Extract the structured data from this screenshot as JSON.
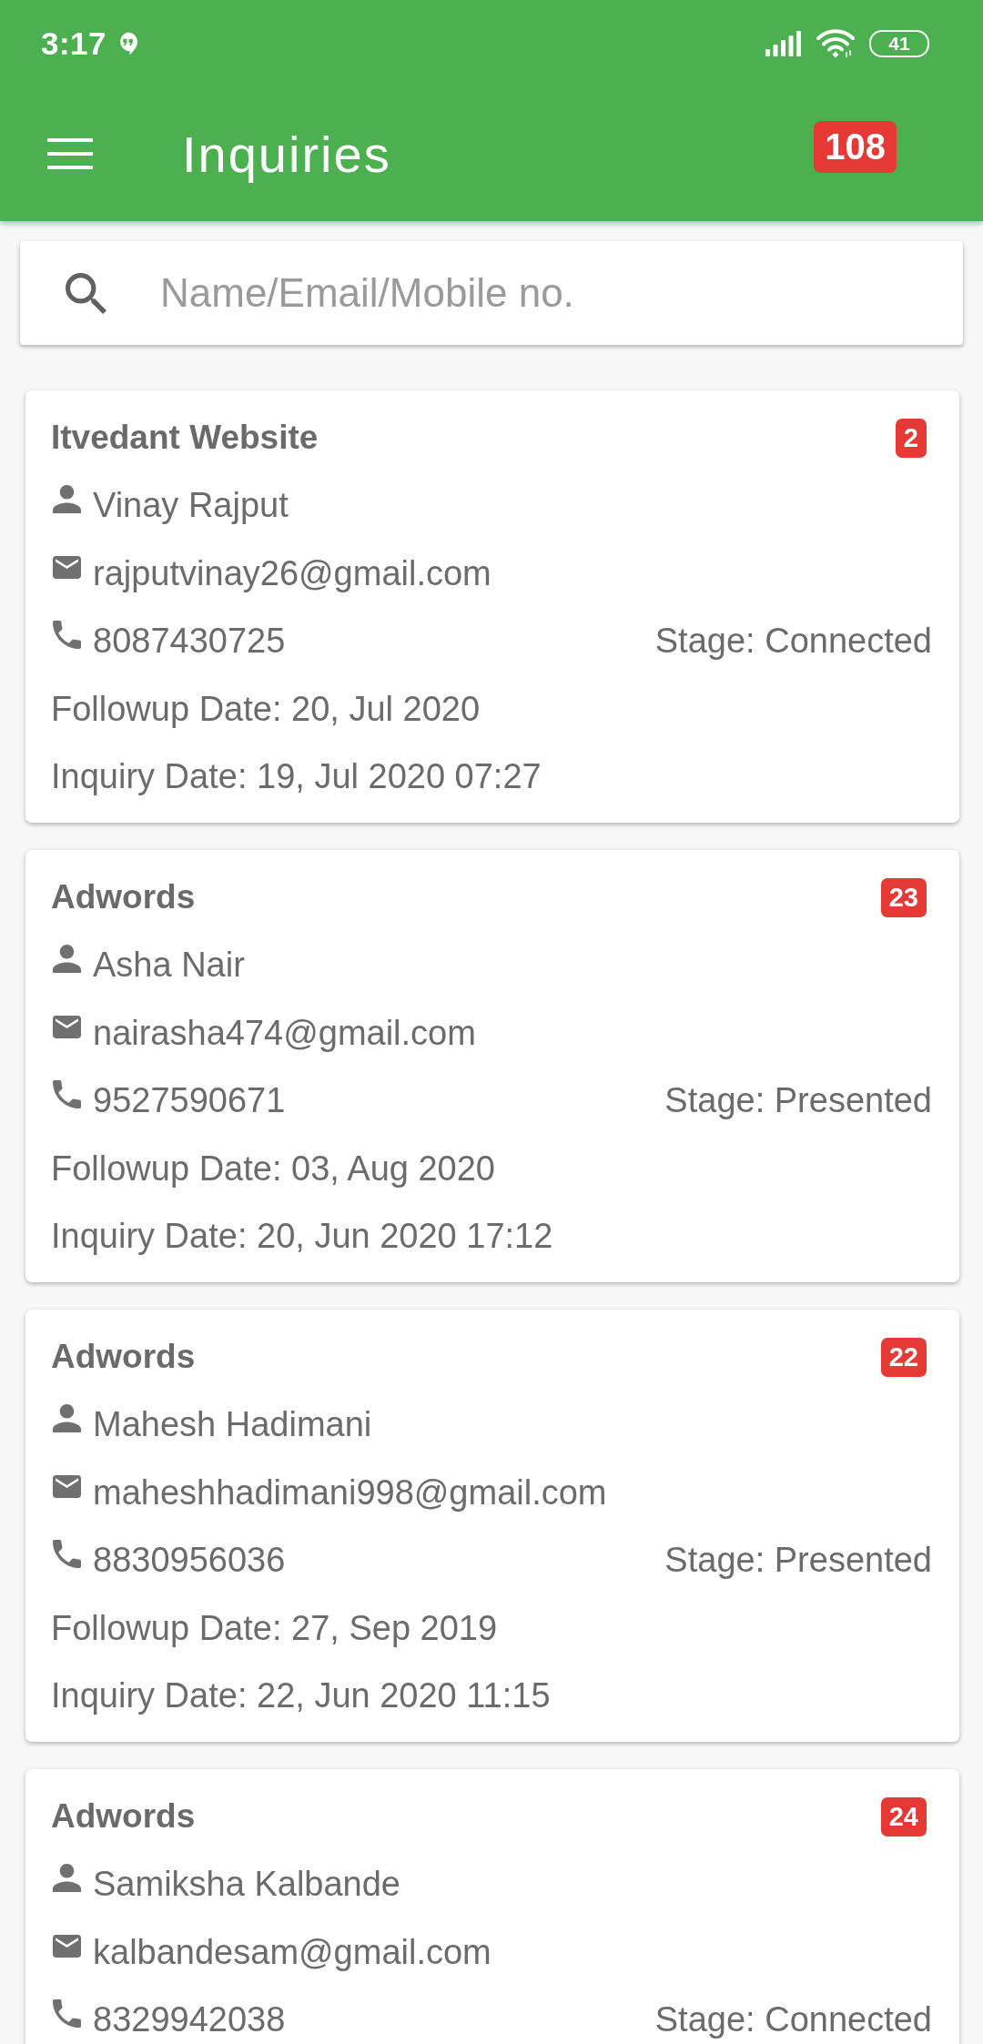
{
  "status_bar": {
    "time": "3:17",
    "battery": "41"
  },
  "toolbar": {
    "title": "Inquiries",
    "badge": "108"
  },
  "search": {
    "placeholder": "Name/Email/Mobile no."
  },
  "inquiries": [
    {
      "source": "Itvedant Website",
      "count": "2",
      "name": "Vinay Rajput",
      "email": "rajputvinay26@gmail.com",
      "phone": "8087430725",
      "stage": "Stage: Connected",
      "followup": "Followup Date: 20, Jul 2020",
      "inquiry_date": "Inquiry Date: 19, Jul 2020 07:27"
    },
    {
      "source": "Adwords",
      "count": "23",
      "name": "Asha Nair",
      "email": "nairasha474@gmail.com",
      "phone": "9527590671",
      "stage": "Stage: Presented",
      "followup": "Followup Date: 03, Aug 2020",
      "inquiry_date": "Inquiry Date: 20, Jun 2020 17:12"
    },
    {
      "source": "Adwords",
      "count": "22",
      "name": "Mahesh Hadimani",
      "email": "maheshhadimani998@gmail.com",
      "phone": "8830956036",
      "stage": "Stage: Presented",
      "followup": "Followup Date: 27, Sep 2019",
      "inquiry_date": "Inquiry Date: 22, Jun 2020 11:15"
    },
    {
      "source": "Adwords",
      "count": "24",
      "name": "Samiksha Kalbande",
      "email": "kalbandesam@gmail.com",
      "phone": "8329942038",
      "stage": "Stage: Connected"
    }
  ]
}
